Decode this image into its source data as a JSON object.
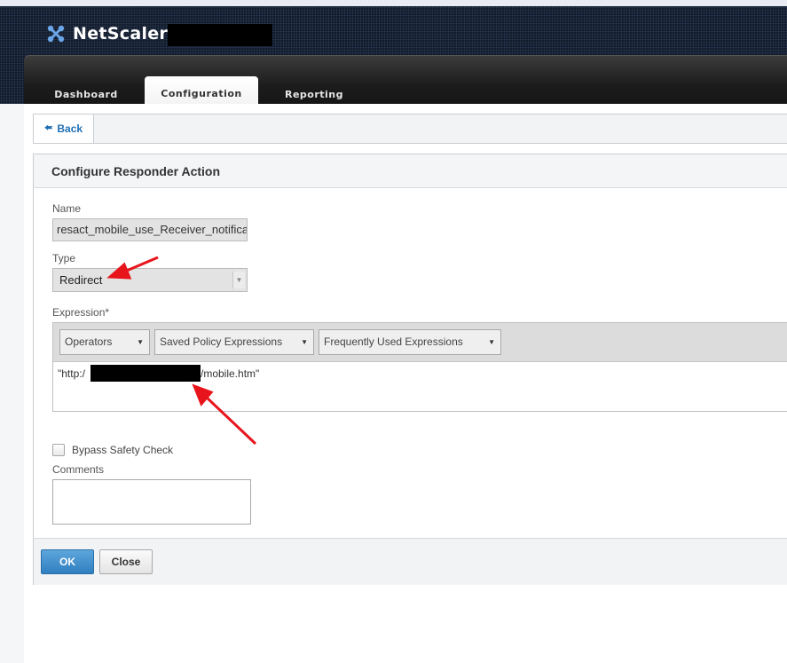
{
  "header": {
    "brand_name": "NetScaler",
    "tabs": [
      {
        "label": "Dashboard"
      },
      {
        "label": "Configuration"
      },
      {
        "label": "Reporting"
      }
    ]
  },
  "toolbar": {
    "back_label": "Back"
  },
  "form": {
    "title": "Configure Responder Action",
    "name_label": "Name",
    "name_value": "resact_mobile_use_Receiver_notificati",
    "type_label": "Type",
    "type_value": "Redirect",
    "expression_label": "Expression*",
    "operators_label": "Operators",
    "saved_policy_label": "Saved Policy Expressions",
    "frequent_label": "Frequently Used Expressions",
    "expression_prefix": "\"http:/",
    "expression_suffix": "/mobile.htm\"",
    "bypass_label": "Bypass Safety Check",
    "bypass_checked": false,
    "comments_label": "Comments",
    "comments_value": ""
  },
  "footer": {
    "ok_label": "OK",
    "close_label": "Close"
  },
  "colors": {
    "accent": "#2f7fc0",
    "annotation_arrow": "#e8141c",
    "link": "#1f6fb2"
  },
  "icons": {
    "brand": "netscaler-logo-icon",
    "back": "left-arrow-icon",
    "dropdown": "chevron-down-icon"
  }
}
